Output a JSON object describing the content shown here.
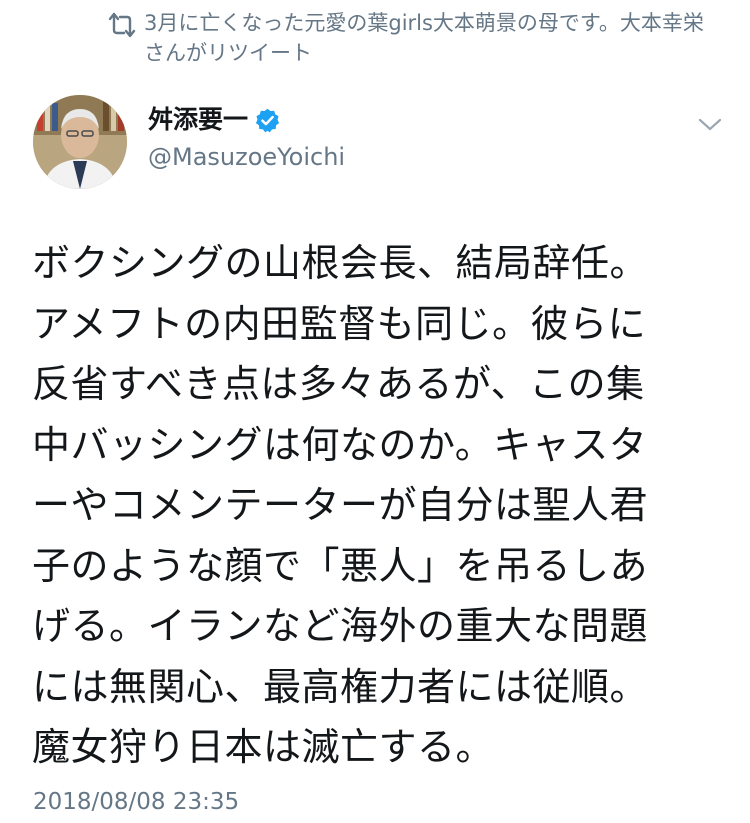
{
  "retweet_context": {
    "text": "3月に亡くなった元愛の葉girls大本萌景の母です。大本幸栄さんがリツイート"
  },
  "author": {
    "display_name": "舛添要一",
    "handle": "@MasuzoeYoichi",
    "verified": true
  },
  "tweet": {
    "text": "ボクシングの山根会長、結局辞任。\nアメフトの内田監督も同じ。彼らに\n反省すべき点は多々あるが、この集\n中バッシングは何なのか。キャスタ\nーやコメンテーターが自分は聖人君\n子のような顔で「悪人」を吊るしあ\nげる。イランなど海外の重大な問題\nには無関心、最高権力者には従順。\n魔女狩り日本は滅亡する。",
    "timestamp": "2018/08/08 23:35"
  },
  "colors": {
    "text_primary": "#14171a",
    "text_secondary": "#657786",
    "verified_blue": "#1da1f2",
    "background": "#ffffff"
  },
  "icons": {
    "retweet": "retweet-icon",
    "verified": "verified-badge-icon",
    "menu": "chevron-down-icon"
  }
}
